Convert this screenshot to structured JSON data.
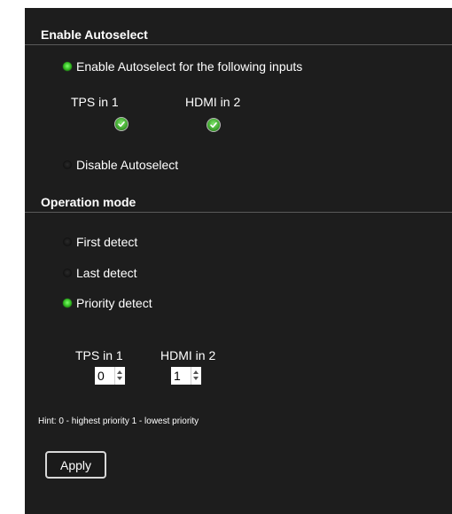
{
  "autoselect": {
    "title": "Enable Autoselect",
    "enable_label": "Enable Autoselect for the following inputs",
    "enabled": true,
    "inputs": [
      {
        "label": "TPS in 1",
        "checked": true
      },
      {
        "label": "HDMI in 2",
        "checked": true
      }
    ],
    "disable_label": "Disable Autoselect"
  },
  "operation": {
    "title": "Operation mode",
    "options": [
      {
        "label": "First detect",
        "selected": false
      },
      {
        "label": "Last detect",
        "selected": false
      },
      {
        "label": "Priority detect",
        "selected": true
      }
    ],
    "priority": [
      {
        "label": "TPS in 1",
        "value": "0"
      },
      {
        "label": "HDMI in 2",
        "value": "1"
      }
    ],
    "hint": "Hint: 0 - highest priority 1 - lowest priority",
    "apply_label": "Apply"
  },
  "colors": {
    "panel_bg": "#1d1d1d",
    "radio_on": "#2fb51d",
    "check": "#3fa52e"
  },
  "icons": {
    "radio": "radio-dot",
    "check": "checkmark-icon",
    "spinner": "up-down-arrows"
  }
}
